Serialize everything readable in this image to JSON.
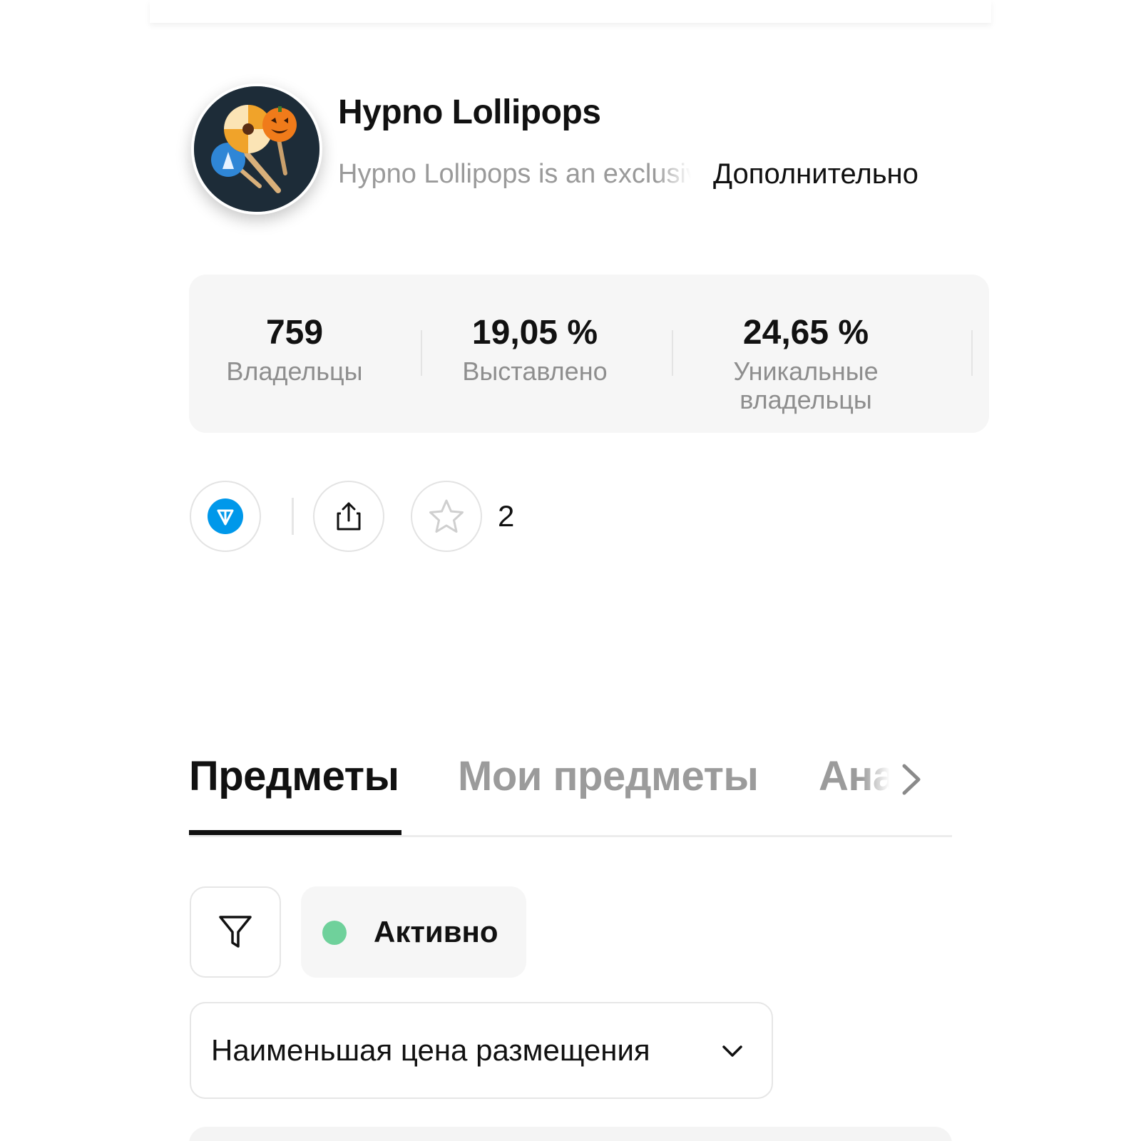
{
  "collection": {
    "name": "Hypno Lollipops",
    "description": "Hypno Lollipops is an exclusive",
    "more_label": "Дополнительно"
  },
  "stats": [
    {
      "value": "759",
      "label": "Владельцы"
    },
    {
      "value": "19,05 %",
      "label": "Выставлено"
    },
    {
      "value": "24,65 %",
      "label": "Уникальные владельцы"
    }
  ],
  "actions": {
    "ton_icon": "ton-diamond-icon",
    "share_icon": "share-icon",
    "favorite_icon": "star-icon",
    "favorite_count": "2"
  },
  "tabs": [
    {
      "label": "Предметы",
      "active": true
    },
    {
      "label": "Мои предметы",
      "active": false
    },
    {
      "label": "Ана",
      "active": false
    }
  ],
  "filters": {
    "filter_icon": "funnel-icon",
    "status_label": "Активно",
    "status_color": "#6fd19b"
  },
  "sort": {
    "selected": "Наименьшая цена размещения",
    "chevron_icon": "chevron-down-icon"
  },
  "colors": {
    "ton_blue": "#0098EA",
    "muted_text": "#9b9b9b",
    "stats_bg": "#f6f6f6"
  }
}
